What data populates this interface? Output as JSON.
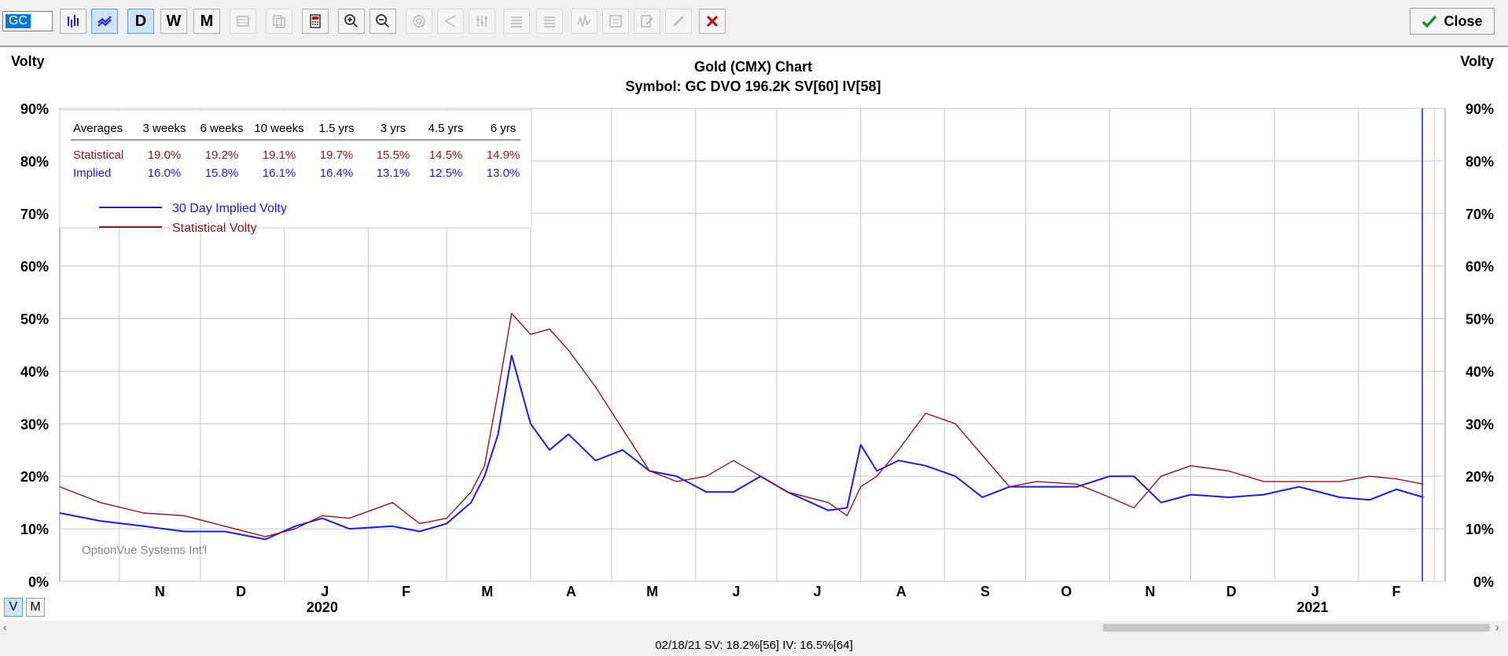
{
  "toolbar": {
    "symbol": "GC",
    "period_buttons": [
      "D",
      "W",
      "M"
    ],
    "close_label": "Close"
  },
  "chart": {
    "title": "Gold (CMX) Chart",
    "subtitle": "Symbol: GC  DVO 196.2K  SV[60]  IV[58]",
    "left_axis_label": "Volty",
    "right_axis_label": "Volty",
    "watermark": "OptionVue Systems Int'l",
    "year_labels": [
      "2020",
      "2021"
    ],
    "averages_table": {
      "headers": [
        "Averages",
        "3 weeks",
        "6 weeks",
        "10 weeks",
        "1.5 yrs",
        "3 yrs",
        "4.5 yrs",
        "6 yrs"
      ],
      "rows": [
        {
          "label": "Statistical",
          "values": [
            "19.0%",
            "19.2%",
            "19.1%",
            "19.7%",
            "15.5%",
            "14.5%",
            "14.9%"
          ]
        },
        {
          "label": "Implied",
          "values": [
            "16.0%",
            "15.8%",
            "16.1%",
            "16.4%",
            "13.1%",
            "12.5%",
            "13.0%"
          ]
        }
      ]
    },
    "colors": {
      "implied": "#1a1aff",
      "statistical": "#8b1a1a",
      "grid": "#c8c8c8"
    }
  },
  "view_toggle": {
    "v": "V",
    "m": "M"
  },
  "status_text": "02/18/21   SV: 18.2%[56]   IV: 16.5%[64]",
  "chart_data": {
    "type": "line",
    "xlabel": "",
    "ylabel": "Volty",
    "ylim": [
      0,
      90
    ],
    "yticks": [
      "0%",
      "10%",
      "20%",
      "30%",
      "40%",
      "50%",
      "60%",
      "70%",
      "80%",
      "90%"
    ],
    "x_month_labels": [
      "N",
      "D",
      "J",
      "F",
      "M",
      "A",
      "M",
      "J",
      "J",
      "A",
      "S",
      "O",
      "N",
      "D",
      "J",
      "F"
    ],
    "x_range": [
      "2019-10-10",
      "2021-03-05"
    ],
    "series": [
      {
        "name": "30 Day Implied Volty",
        "color": "#1a1aff",
        "x": [
          "2019-10-10",
          "2019-10-25",
          "2019-11-10",
          "2019-11-25",
          "2019-12-10",
          "2019-12-25",
          "2020-01-05",
          "2020-01-15",
          "2020-01-25",
          "2020-02-10",
          "2020-02-20",
          "2020-03-01",
          "2020-03-10",
          "2020-03-15",
          "2020-03-20",
          "2020-03-25",
          "2020-04-01",
          "2020-04-08",
          "2020-04-15",
          "2020-04-25",
          "2020-05-05",
          "2020-05-15",
          "2020-05-25",
          "2020-06-05",
          "2020-06-15",
          "2020-06-25",
          "2020-07-05",
          "2020-07-20",
          "2020-07-27",
          "2020-08-01",
          "2020-08-07",
          "2020-08-15",
          "2020-08-25",
          "2020-09-05",
          "2020-09-15",
          "2020-09-25",
          "2020-10-05",
          "2020-10-20",
          "2020-11-01",
          "2020-11-10",
          "2020-11-20",
          "2020-12-01",
          "2020-12-15",
          "2020-12-28",
          "2021-01-10",
          "2021-01-25",
          "2021-02-05",
          "2021-02-15",
          "2021-02-25"
        ],
        "y": [
          13,
          11.5,
          10.5,
          9.5,
          9.5,
          8,
          10.5,
          12,
          10,
          10.5,
          9.5,
          11,
          15,
          20,
          28,
          43,
          30,
          25,
          28,
          23,
          25,
          21,
          20,
          17,
          17,
          20,
          17,
          13.5,
          14,
          26,
          21,
          23,
          22,
          20,
          16,
          18,
          18,
          18,
          20,
          20,
          15,
          16.5,
          16,
          16.5,
          18,
          16,
          15.5,
          17.5,
          16
        ]
      },
      {
        "name": "Statistical Volty",
        "color": "#8b1a1a",
        "x": [
          "2019-10-10",
          "2019-10-25",
          "2019-11-10",
          "2019-11-25",
          "2019-12-10",
          "2019-12-25",
          "2020-01-05",
          "2020-01-15",
          "2020-01-25",
          "2020-02-10",
          "2020-02-20",
          "2020-03-01",
          "2020-03-10",
          "2020-03-15",
          "2020-03-20",
          "2020-03-25",
          "2020-04-01",
          "2020-04-08",
          "2020-04-15",
          "2020-04-25",
          "2020-05-05",
          "2020-05-15",
          "2020-05-25",
          "2020-06-05",
          "2020-06-15",
          "2020-06-25",
          "2020-07-05",
          "2020-07-20",
          "2020-07-27",
          "2020-08-01",
          "2020-08-07",
          "2020-08-15",
          "2020-08-25",
          "2020-09-05",
          "2020-09-15",
          "2020-09-25",
          "2020-10-05",
          "2020-10-20",
          "2020-11-01",
          "2020-11-10",
          "2020-11-20",
          "2020-12-01",
          "2020-12-15",
          "2020-12-28",
          "2021-01-10",
          "2021-01-25",
          "2021-02-05",
          "2021-02-15",
          "2021-02-25"
        ],
        "y": [
          18,
          15,
          13,
          12.5,
          10.5,
          8.5,
          10,
          12.5,
          12,
          15,
          11,
          12,
          17,
          22,
          36,
          51,
          47,
          48,
          44,
          37,
          29,
          21,
          19,
          20,
          23,
          20,
          17,
          15,
          12.5,
          18,
          20,
          25,
          32,
          30,
          24,
          18,
          19,
          18.5,
          16,
          14,
          20,
          22,
          21,
          19,
          19,
          19,
          20,
          19.5,
          18.5
        ]
      }
    ]
  }
}
